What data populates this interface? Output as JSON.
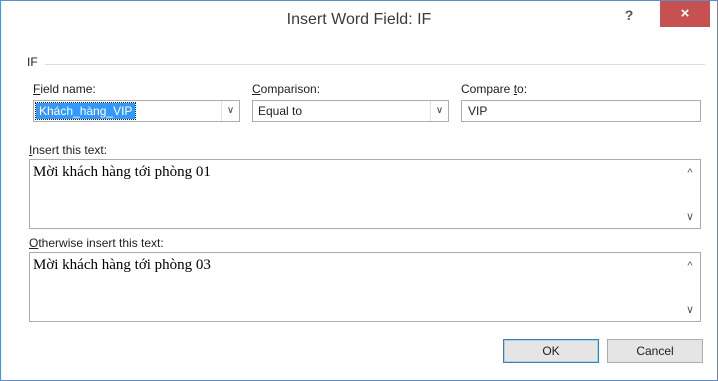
{
  "window": {
    "title": "Insert Word Field: IF",
    "help_glyph": "?",
    "close_glyph": "×"
  },
  "section": {
    "label": "IF"
  },
  "field_name": {
    "label_ul": "F",
    "label_rest": "ield name:",
    "value": "Khách_hàng_VIP",
    "arrow": "∨"
  },
  "comparison": {
    "label_ul": "C",
    "label_rest": "omparison:",
    "value": "Equal to",
    "arrow": "∨"
  },
  "compare_to": {
    "label_pre": "Compare ",
    "label_ul": "t",
    "label_rest": "o:",
    "value": "VIP"
  },
  "insert_text": {
    "label_ul": "I",
    "label_rest": "nsert this text:",
    "value": "Mời khách hàng tới phòng 01"
  },
  "otherwise_text": {
    "label_ul": "O",
    "label_rest": "therwise insert this text:",
    "value": "Mời khách hàng tới phòng 03"
  },
  "scroll": {
    "up": "^",
    "down": "∨"
  },
  "buttons": {
    "ok": "OK",
    "cancel": "Cancel"
  }
}
